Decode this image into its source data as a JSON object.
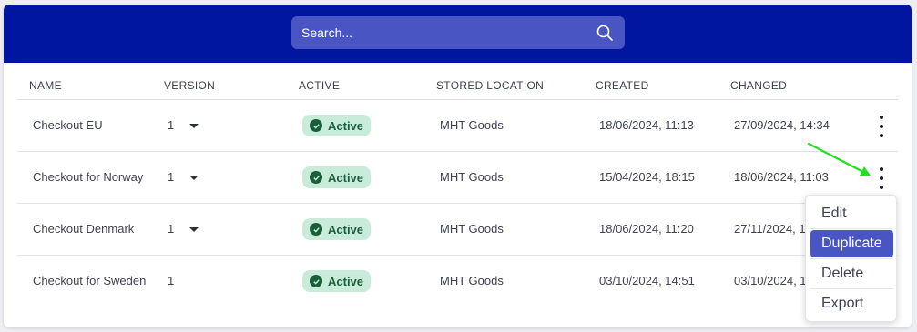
{
  "search": {
    "placeholder": "Search..."
  },
  "table": {
    "columns": [
      "NAME",
      "VERSION",
      "ACTIVE",
      "STORED LOCATION",
      "CREATED",
      "CHANGED"
    ],
    "rows": [
      {
        "name": "Checkout EU",
        "version": "1",
        "has_version_dropdown": true,
        "status": "Active",
        "location": "MHT Goods",
        "created": "18/06/2024, 11:13",
        "changed": "27/09/2024, 14:34"
      },
      {
        "name": "Checkout for Norway",
        "version": "1",
        "has_version_dropdown": true,
        "status": "Active",
        "location": "MHT Goods",
        "created": "15/04/2024, 18:15",
        "changed": "18/06/2024, 11:03"
      },
      {
        "name": "Checkout Denmark",
        "version": "1",
        "has_version_dropdown": true,
        "status": "Active",
        "location": "MHT Goods",
        "created": "18/06/2024, 11:20",
        "changed": "27/11/2024, 1"
      },
      {
        "name": "Checkout for Sweden",
        "version": "1",
        "has_version_dropdown": false,
        "status": "Active",
        "location": "MHT Goods",
        "created": "03/10/2024, 14:51",
        "changed": "03/10/2024, 1"
      }
    ]
  },
  "context_menu": {
    "items": [
      "Edit",
      "Duplicate",
      "Delete",
      "Export"
    ],
    "highlighted": "Duplicate"
  },
  "colors": {
    "header_bg": "#0016a0",
    "search_bg": "#4a55c4",
    "badge_bg": "#c8ecd9",
    "badge_text": "#1a5e3a",
    "menu_highlight": "#4a55c4",
    "annotation_arrow": "#22dd22"
  },
  "icons": {
    "search": "search-icon",
    "status": "check-circle-icon",
    "row_menu": "more-vertical-icon",
    "version_dropdown": "caret-down-icon"
  }
}
